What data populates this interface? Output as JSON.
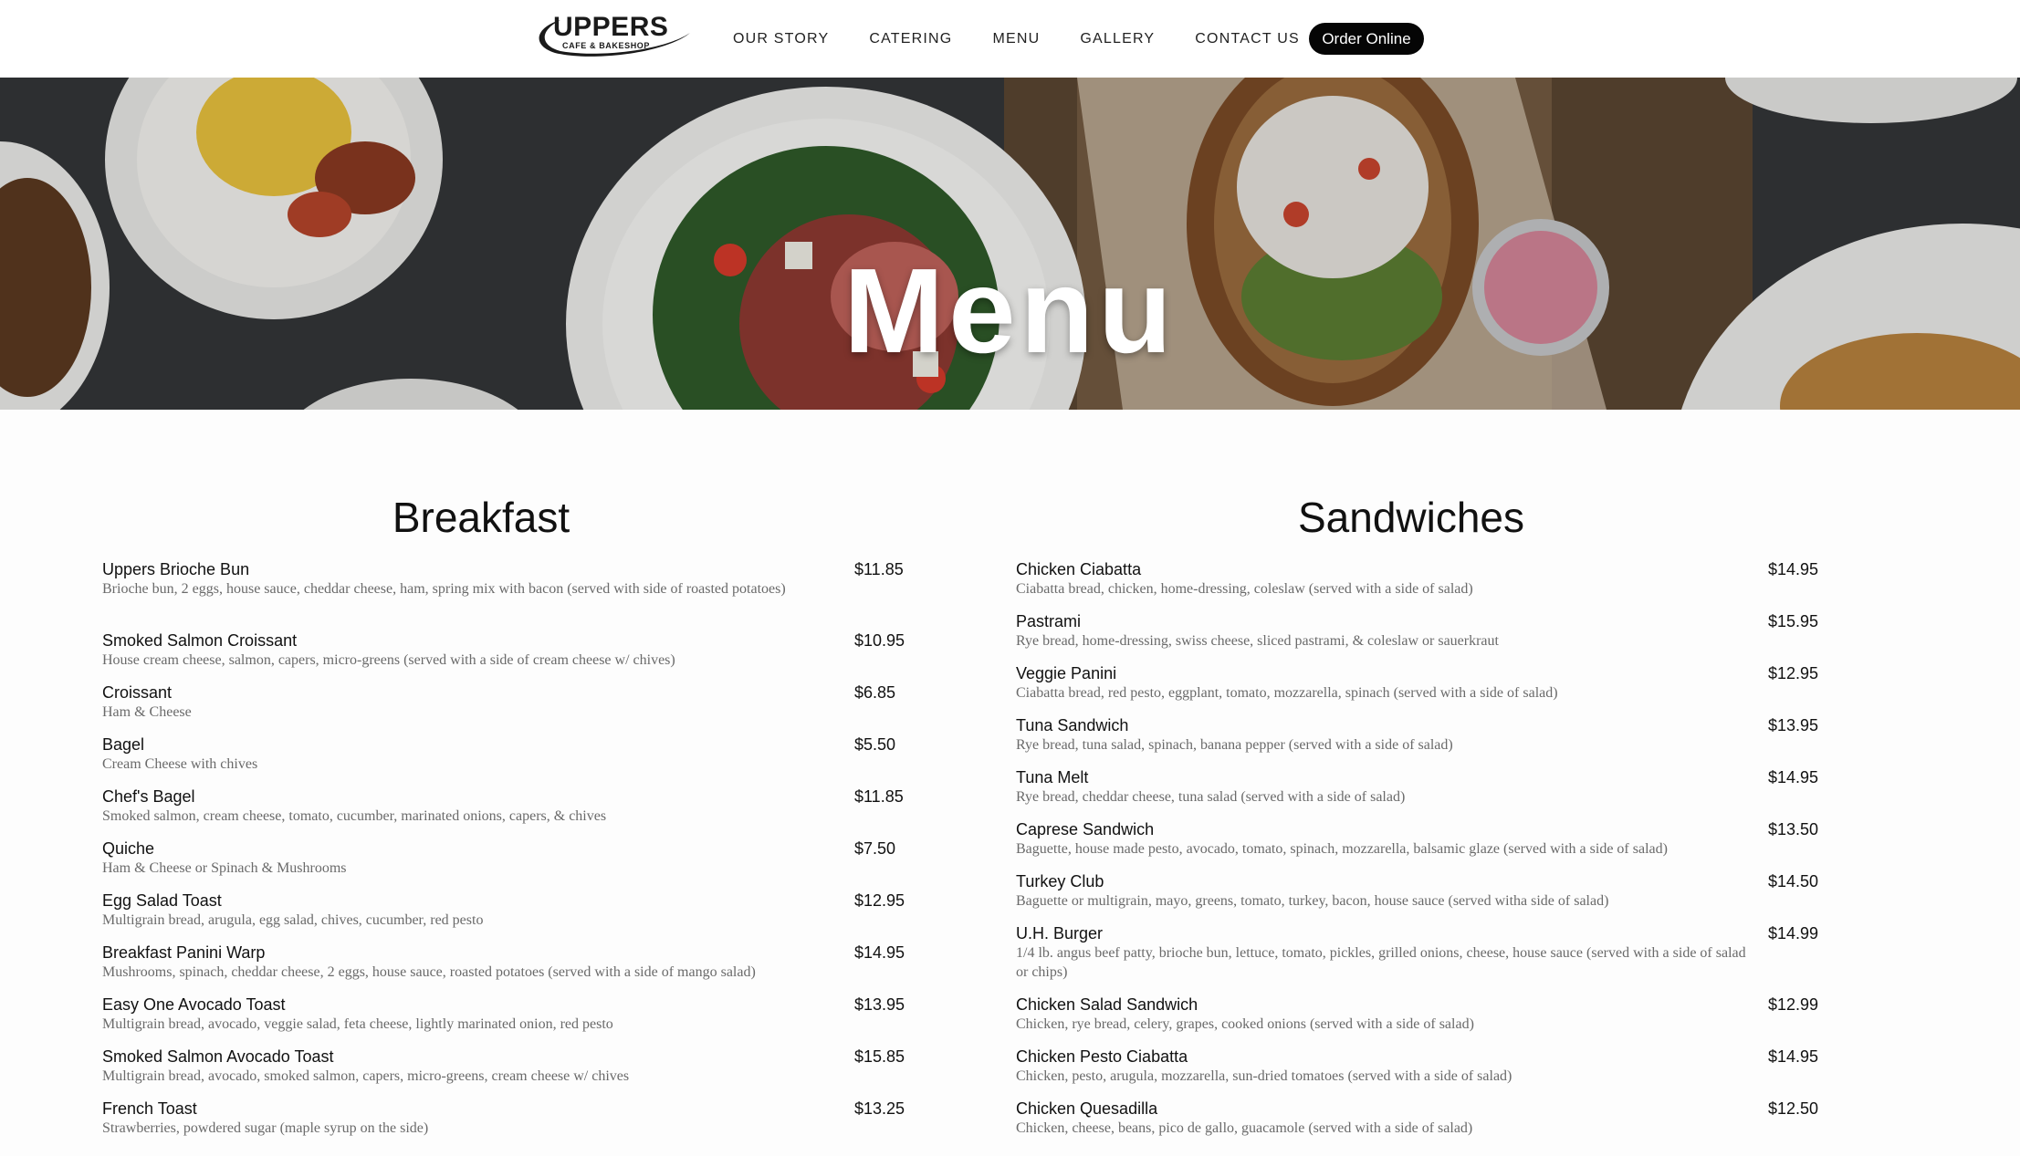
{
  "header": {
    "logo": {
      "brand": "UPPERS",
      "tagline": "CAFE & BAKESHOP"
    },
    "nav": [
      "OUR STORY",
      "CATERING",
      "MENU",
      "GALLERY",
      "CONTACT US"
    ],
    "order_button": "Order Online"
  },
  "hero": {
    "title": "Menu"
  },
  "breakfast": {
    "title": "Breakfast",
    "items": [
      {
        "name": "Uppers Brioche Bun",
        "price": "$11.85",
        "desc": "Brioche bun, 2 eggs, house sauce, cheddar cheese, ham, spring mix with bacon (served with side of roasted potatoes)"
      },
      {
        "name": "Smoked Salmon Croissant",
        "price": "$10.95",
        "desc": "House cream cheese, salmon, capers, micro-greens (served with a side of cream cheese w/ chives)"
      },
      {
        "name": "Croissant",
        "price": "$6.85",
        "desc": "Ham & Cheese"
      },
      {
        "name": "Bagel",
        "price": "$5.50",
        "desc": "Cream Cheese with chives"
      },
      {
        "name": "Chef's Bagel",
        "price": "$11.85",
        "desc": "Smoked salmon, cream cheese, tomato, cucumber, marinated onions, capers, & chives"
      },
      {
        "name": "Quiche",
        "price": "$7.50",
        "desc": "Ham & Cheese or Spinach & Mushrooms"
      },
      {
        "name": "Egg Salad Toast",
        "price": "$12.95",
        "desc": "Multigrain bread, arugula, egg salad, chives, cucumber, red pesto"
      },
      {
        "name": "Breakfast Panini Warp",
        "price": "$14.95",
        "desc": "Mushrooms, spinach, cheddar cheese, 2 eggs, house sauce, roasted potatoes (served with a side of mango salad)"
      },
      {
        "name": "Easy One Avocado Toast",
        "price": "$13.95",
        "desc": "Multigrain bread, avocado, veggie salad, feta cheese, lightly marinated onion, red pesto"
      },
      {
        "name": "Smoked Salmon Avocado Toast",
        "price": "$15.85",
        "desc": "Multigrain bread, avocado, smoked salmon, capers, micro-greens, cream cheese w/ chives"
      },
      {
        "name": "French Toast",
        "price": "$13.25",
        "desc": "Strawberries, powdered sugar (maple syrup on the side)"
      }
    ]
  },
  "sandwiches": {
    "title": "Sandwiches",
    "items": [
      {
        "name": "Chicken Ciabatta",
        "price": "$14.95",
        "desc": "Ciabatta bread, chicken, home-dressing, coleslaw (served with a side of salad)"
      },
      {
        "name": "Pastrami",
        "price": "$15.95",
        "desc": "Rye bread, home-dressing, swiss cheese, sliced pastrami, & coleslaw or sauerkraut"
      },
      {
        "name": "Veggie Panini",
        "price": "$12.95",
        "desc": "Ciabatta bread, red pesto, eggplant, tomato, mozzarella, spinach (served with a side of salad)"
      },
      {
        "name": "Tuna Sandwich",
        "price": "$13.95",
        "desc": "Rye bread, tuna salad, spinach, banana pepper (served with a side of salad)"
      },
      {
        "name": "Tuna Melt",
        "price": "$14.95",
        "desc": "Rye bread, cheddar cheese, tuna salad (served with a side of salad)"
      },
      {
        "name": "Caprese Sandwich",
        "price": "$13.50",
        "desc": "Baguette, house made pesto, avocado, tomato, spinach, mozzarella, balsamic glaze (served with a side of salad)"
      },
      {
        "name": "Turkey Club",
        "price": "$14.50",
        "desc": "Baguette or multigrain, mayo, greens, tomato, turkey, bacon, house sauce (served witha side of salad)"
      },
      {
        "name": "U.H. Burger",
        "price": "$14.99",
        "desc": "1/4 lb. angus beef patty, brioche bun, lettuce, tomato, pickles, grilled onions, cheese, house sauce (served with a side of salad or chips)"
      },
      {
        "name": "Chicken Salad Sandwich",
        "price": "$12.99",
        "desc": "Chicken, rye bread, celery, grapes, cooked onions (served with a side of salad)"
      },
      {
        "name": "Chicken Pesto Ciabatta",
        "price": "$14.95",
        "desc": "Chicken, pesto, arugula, mozzarella, sun-dried tomatoes (served with a side of salad)"
      },
      {
        "name": "Chicken Quesadilla",
        "price": "$12.50",
        "desc": "Chicken, cheese, beans, pico de gallo, guacamole (served with a side of salad)"
      }
    ]
  }
}
